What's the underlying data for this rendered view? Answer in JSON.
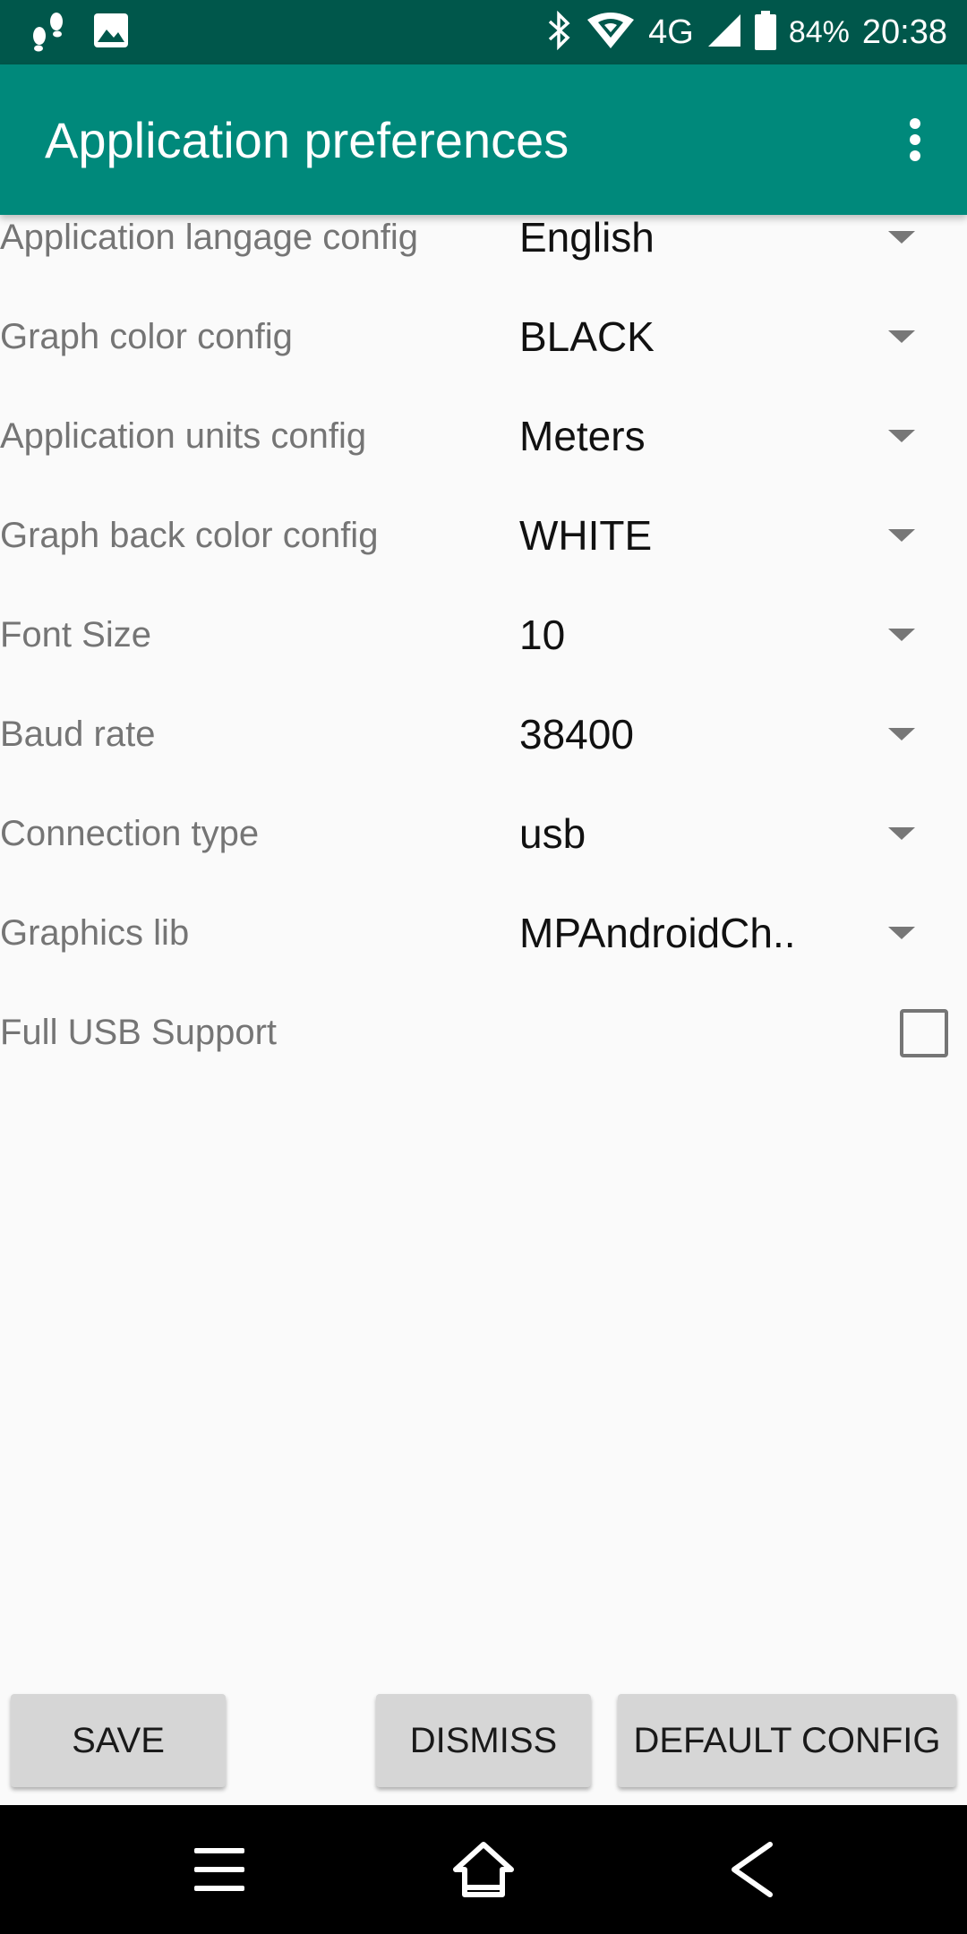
{
  "status_bar": {
    "network": "4G",
    "battery_percent": "84%",
    "time": "20:38",
    "icons": [
      "footsteps-icon",
      "image-icon",
      "bluetooth-icon",
      "wifi-icon",
      "signal-icon",
      "battery-icon"
    ]
  },
  "app_bar": {
    "title": "Application preferences",
    "overflow_icon": "more-vert-icon"
  },
  "preferences": [
    {
      "label": "Application langage config",
      "value": "English"
    },
    {
      "label": "Graph color config",
      "value": "BLACK"
    },
    {
      "label": "Application units config",
      "value": "Meters"
    },
    {
      "label": "Graph back color config",
      "value": "WHITE"
    },
    {
      "label": "Font Size",
      "value": "10"
    },
    {
      "label": "Baud rate",
      "value": "38400"
    },
    {
      "label": "Connection type",
      "value": "usb"
    },
    {
      "label": "Graphics lib",
      "value": "MPAndroidCh.."
    }
  ],
  "full_usb": {
    "label": "Full USB Support",
    "checked": false
  },
  "buttons": {
    "save": "SAVE",
    "dismiss": "DISMISS",
    "default_config": "DEFAULT CONFIG"
  },
  "nav_bar": {
    "icons": [
      "menu-icon",
      "home-icon",
      "back-icon"
    ]
  },
  "colors": {
    "status_bar": "#00574b",
    "app_bar": "#00897b",
    "background": "#fafafa",
    "button": "#d6d6d6"
  }
}
